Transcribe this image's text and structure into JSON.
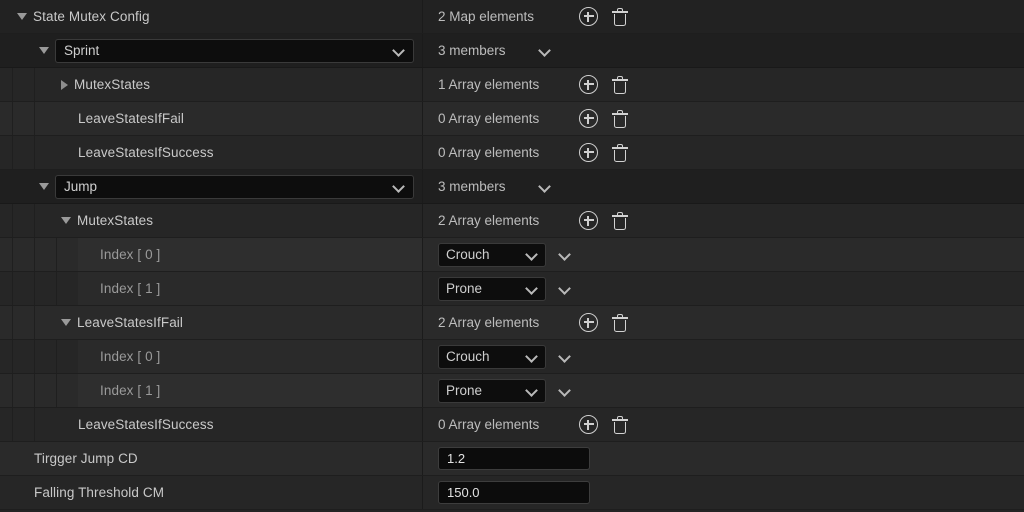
{
  "panel": {
    "name": "state-mutex-config-details"
  },
  "icons": {
    "add": "plus-circle-icon",
    "remove": "trash-icon",
    "expanded": "triangle-down-icon",
    "collapsed": "triangle-right-icon",
    "dropdown": "chevron-down-icon"
  },
  "rows": [
    {
      "id": "state-mutex-config",
      "label": "State Mutex Config",
      "value": "2 Map elements",
      "twisty": "down",
      "indent": 0,
      "kind": "header",
      "shade": "dark",
      "actions": true
    },
    {
      "id": "map-key-sprint",
      "label": "Sprint",
      "value": "3 members",
      "twisty": "down",
      "indent": 1,
      "kind": "combo",
      "shade": "combo",
      "actions": false,
      "member_chevron": true
    },
    {
      "id": "sprint-mutexstates",
      "label": "MutexStates",
      "value": "1 Array elements",
      "twisty": "right",
      "indent": 2,
      "kind": "plain",
      "shade": "alt",
      "actions": true
    },
    {
      "id": "sprint-leavestatesiffail",
      "label": "LeaveStatesIfFail",
      "value": "0 Array elements",
      "twisty": "none",
      "indent": 2,
      "kind": "plain",
      "shade": "normal",
      "actions": true
    },
    {
      "id": "sprint-leavestatesifsuccess",
      "label": "LeaveStatesIfSuccess",
      "value": "0 Array elements",
      "twisty": "none",
      "indent": 2,
      "kind": "plain",
      "shade": "alt",
      "actions": true
    },
    {
      "id": "map-key-jump",
      "label": "Jump",
      "value": "3 members",
      "twisty": "down",
      "indent": 1,
      "kind": "combo",
      "shade": "combo",
      "actions": false,
      "member_chevron": true
    },
    {
      "id": "jump-mutexstates",
      "label": "MutexStates",
      "value": "2 Array elements",
      "twisty": "down",
      "indent": 2,
      "kind": "plain",
      "shade": "alt",
      "actions": true
    },
    {
      "id": "jump-mutexstates-index-0",
      "label": "Index [ 0 ]",
      "value": "Crouch",
      "twisty": "none",
      "indent": 3,
      "kind": "enum",
      "shade": "normal",
      "actions": false
    },
    {
      "id": "jump-mutexstates-index-1",
      "label": "Index [ 1 ]",
      "value": "Prone",
      "twisty": "none",
      "indent": 3,
      "kind": "enum",
      "shade": "alt",
      "actions": false
    },
    {
      "id": "jump-leavestatesiffail",
      "label": "LeaveStatesIfFail",
      "value": "2 Array elements",
      "twisty": "down",
      "indent": 2,
      "kind": "plain",
      "shade": "normal",
      "actions": true
    },
    {
      "id": "jump-leavestatesiffail-index-0",
      "label": "Index [ 0 ]",
      "value": "Crouch",
      "twisty": "none",
      "indent": 3,
      "kind": "enum",
      "shade": "alt",
      "actions": false
    },
    {
      "id": "jump-leavestatesiffail-index-1",
      "label": "Index [ 1 ]",
      "value": "Prone",
      "twisty": "none",
      "indent": 3,
      "kind": "enum",
      "shade": "normal",
      "actions": false
    },
    {
      "id": "jump-leavestatesifsuccess",
      "label": "LeaveStatesIfSuccess",
      "value": "0 Array elements",
      "twisty": "none",
      "indent": 2,
      "kind": "plain",
      "shade": "alt",
      "actions": true
    },
    {
      "id": "tirgger-jump-cd",
      "label": "Tirgger Jump CD",
      "value": "1.2",
      "twisty": "none",
      "indent": 0,
      "kind": "number",
      "shade": "normal",
      "actions": false
    },
    {
      "id": "falling-threshold-cm",
      "label": "Falling Threshold CM",
      "value": "150.0",
      "twisty": "none",
      "indent": 0,
      "kind": "number",
      "shade": "alt",
      "actions": false
    }
  ],
  "colors": {
    "background": "#242424",
    "row": "#2a2a2a",
    "row_alt": "#262626",
    "row_dark": "#222222",
    "row_combo": "#1f1f1f",
    "divider": "#1e1e1e",
    "label_text": "#c9c9c9",
    "label_dim": "#9a9a9a",
    "value_text": "#bdbdbd",
    "field_bg": "#0d0d0d",
    "field_border": "#3a3a3a",
    "icon": "#cfcfcf"
  }
}
